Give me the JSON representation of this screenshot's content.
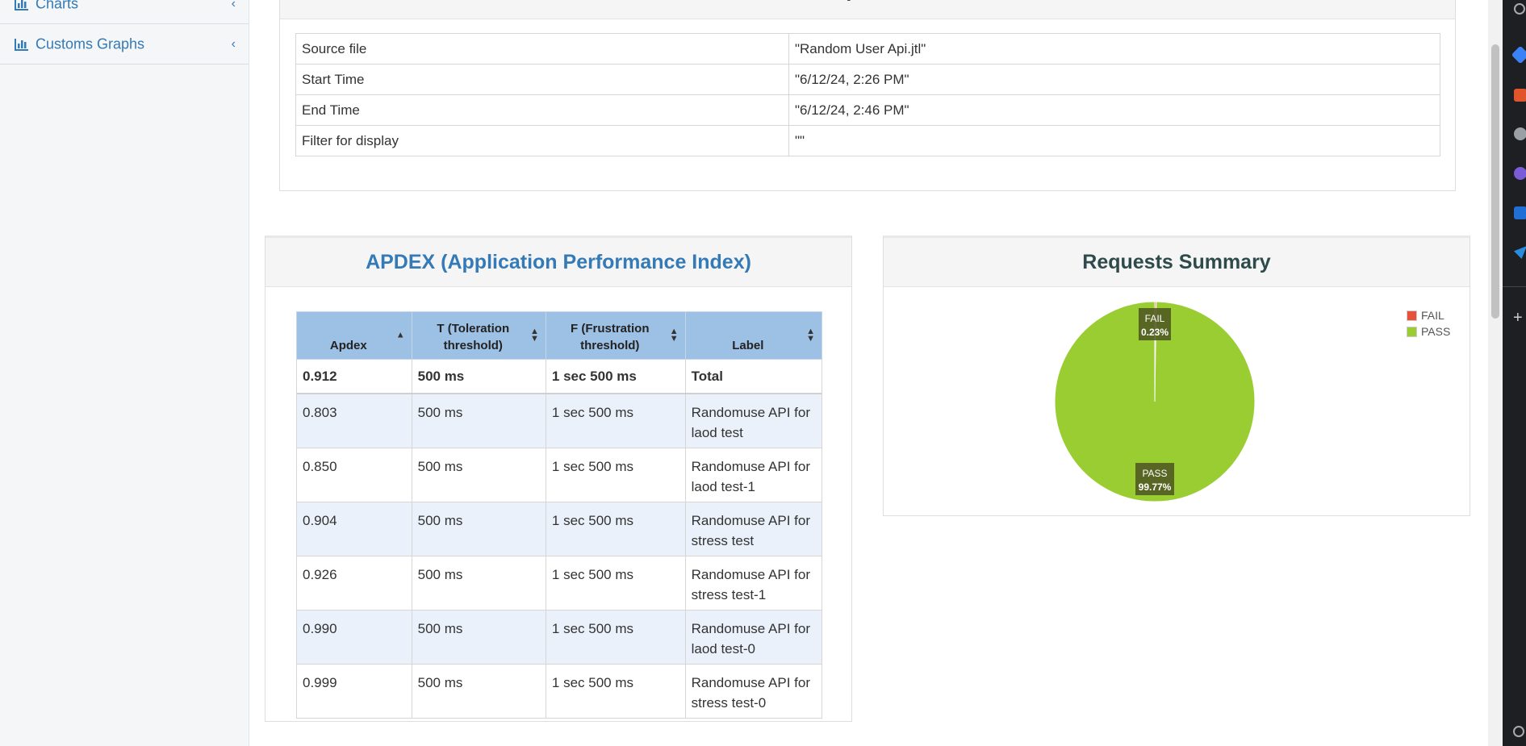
{
  "sidebar": {
    "items": [
      {
        "label": "Charts",
        "icon": "bar-chart-icon"
      },
      {
        "label": "Customs Graphs",
        "icon": "bar-chart-icon"
      }
    ]
  },
  "info": {
    "title": "Test and Report information",
    "rows": [
      {
        "key": "Source file",
        "value": "\"Random User Api.jtl\""
      },
      {
        "key": "Start Time",
        "value": "\"6/12/24, 2:26 PM\""
      },
      {
        "key": "End Time",
        "value": "\"6/12/24, 2:46 PM\""
      },
      {
        "key": "Filter for display",
        "value": "\"\""
      }
    ]
  },
  "apdex": {
    "title": "APDEX (Application Performance Index)",
    "headers": [
      "Apdex",
      "T (Toleration threshold)",
      "F (Frustration threshold)",
      "Label"
    ],
    "total": [
      "0.912",
      "500 ms",
      "1 sec 500 ms",
      "Total"
    ],
    "rows": [
      [
        "0.803",
        "500 ms",
        "1 sec 500 ms",
        "Randomuse API for laod test"
      ],
      [
        "0.850",
        "500 ms",
        "1 sec 500 ms",
        "Randomuse API for laod test-1"
      ],
      [
        "0.904",
        "500 ms",
        "1 sec 500 ms",
        "Randomuse API for stress test"
      ],
      [
        "0.926",
        "500 ms",
        "1 sec 500 ms",
        "Randomuse API for stress test-1"
      ],
      [
        "0.990",
        "500 ms",
        "1 sec 500 ms",
        "Randomuse API for laod test-0"
      ],
      [
        "0.999",
        "500 ms",
        "1 sec 500 ms",
        "Randomuse API for stress test-0"
      ]
    ]
  },
  "summary": {
    "title": "Requests Summary",
    "legend": [
      {
        "label": "FAIL",
        "color": "#e8503a"
      },
      {
        "label": "PASS",
        "color": "#9acd32"
      }
    ]
  },
  "chart_data": {
    "type": "pie",
    "title": "Requests Summary",
    "slices": [
      {
        "label": "FAIL",
        "value": 0.23,
        "display": "0.23%",
        "color": "#e8503a"
      },
      {
        "label": "PASS",
        "value": 99.77,
        "display": "99.77%",
        "color": "#9acd32"
      }
    ],
    "legend_position": "top-right"
  }
}
